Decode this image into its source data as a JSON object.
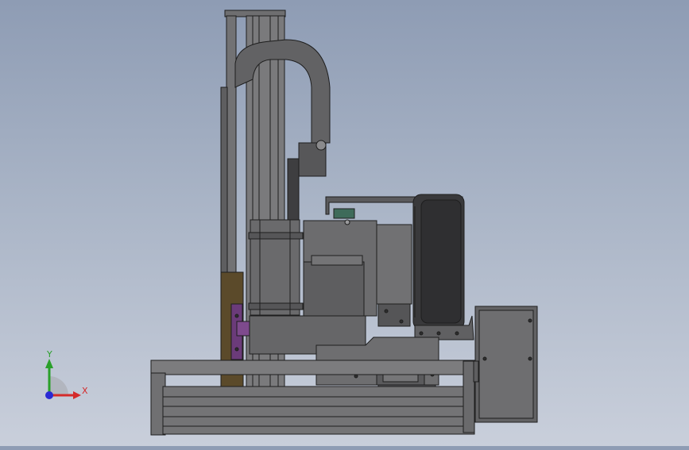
{
  "app": {
    "view": "cad-3d-viewport"
  },
  "triad": {
    "x_label": "X",
    "y_label": "Y",
    "x_color": "#d42a2a",
    "y_color": "#2aa02a",
    "z_color": "#2a2ad4"
  },
  "colors": {
    "background_top": "#8e9cb4",
    "background_bottom": "#c9cfdb",
    "metal": "#6e6e70",
    "metal_dark": "#4a4a4c",
    "edge": "#1e1e1e",
    "bracket": "#6b3b7a",
    "spool": "#3a3a3c",
    "column_accent": "#5b4a2a"
  }
}
